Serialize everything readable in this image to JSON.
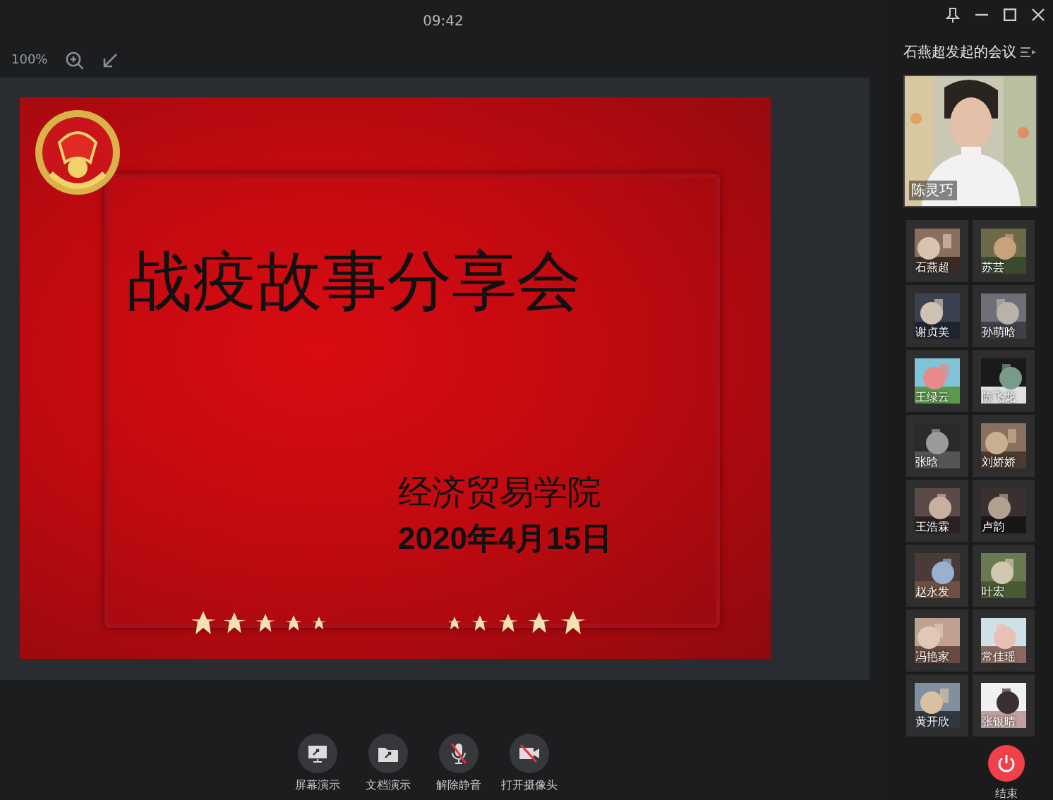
{
  "clock": "09:42",
  "zoom": "100%",
  "slide": {
    "title": "战疫故事分享会",
    "organizer": "经济贸易学院",
    "date": "2020年4月15日"
  },
  "meeting_title": "石燕超发起的会议",
  "speaker": {
    "name": "陈灵巧"
  },
  "participants": [
    {
      "name": "石燕超"
    },
    {
      "name": "苏芸"
    },
    {
      "name": "谢贞美"
    },
    {
      "name": "孙萌晗"
    },
    {
      "name": "王绿云"
    },
    {
      "name": "陈飞龙"
    },
    {
      "name": "张晗"
    },
    {
      "name": "刘娇娇"
    },
    {
      "name": "王浩霖"
    },
    {
      "name": "卢韵"
    },
    {
      "name": "赵永发"
    },
    {
      "name": "叶宏"
    },
    {
      "name": "冯艳家"
    },
    {
      "name": "常佳瑶"
    },
    {
      "name": "黄开欣"
    },
    {
      "name": "张银晴"
    }
  ],
  "controls": [
    {
      "kind": "screen",
      "label": "屏幕演示"
    },
    {
      "kind": "document",
      "label": "文档演示"
    },
    {
      "kind": "mic",
      "label": "解除静音",
      "muted": true
    },
    {
      "kind": "camera",
      "label": "打开摄像头",
      "muted": true
    }
  ],
  "end_button": {
    "label": "结束"
  }
}
